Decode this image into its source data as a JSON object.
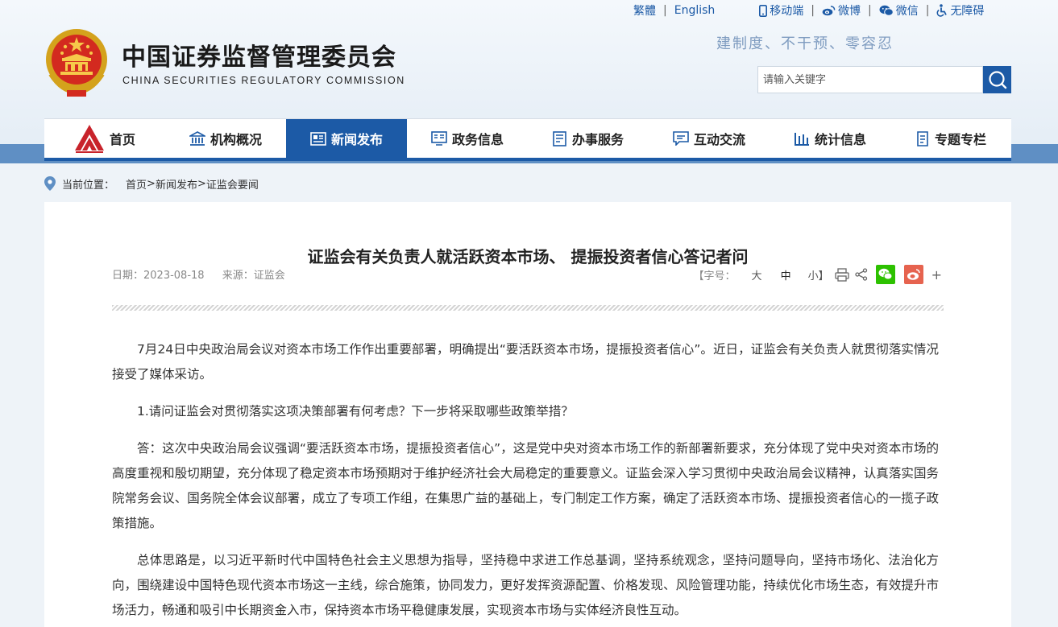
{
  "top_bar": {
    "traditional": "繁體",
    "english": "English",
    "links": [
      {
        "label": "移动端",
        "icon": "mobile-icon"
      },
      {
        "label": "微博",
        "icon": "weibo-icon"
      },
      {
        "label": "微信",
        "icon": "wechat-icon"
      },
      {
        "label": "无障碍",
        "icon": "accessibility-icon"
      }
    ]
  },
  "header": {
    "title": "中国证券监督管理委员会",
    "subtitle": "CHINA SECURITIES REGULATORY COMMISSION",
    "slogan": "建制度、不干预、零容忍",
    "search_placeholder": "请输入关键字"
  },
  "nav": {
    "items": [
      {
        "label": "首页",
        "icon": "home-logo-icon"
      },
      {
        "label": "机构概况",
        "icon": "institution-icon"
      },
      {
        "label": "新闻发布",
        "icon": "news-icon",
        "active": true
      },
      {
        "label": "政务信息",
        "icon": "government-info-icon"
      },
      {
        "label": "办事服务",
        "icon": "service-icon"
      },
      {
        "label": "互动交流",
        "icon": "chat-icon"
      },
      {
        "label": "统计信息",
        "icon": "statistics-icon"
      },
      {
        "label": "专题专栏",
        "icon": "topic-icon"
      }
    ]
  },
  "breadcrumb": {
    "prefix": "当前位置：",
    "items": [
      "首页",
      "新闻发布",
      "证监会要闻"
    ],
    "sep": ">"
  },
  "article": {
    "title": "证监会有关负责人就活跃资本市场、 提振投资者信心答记者问",
    "date_label": "日期：2023-08-18",
    "source_label": "来源：证监会",
    "font_size_label": "【字号：",
    "font_large": "大",
    "font_medium": "中",
    "font_small": "小】",
    "plus": "+",
    "paragraphs": [
      "7月24日中央政治局会议对资本市场工作作出重要部署，明确提出“要活跃资本市场，提振投资者信心”。近日，证监会有关负责人就贯彻落实情况接受了媒体采访。",
      "1.请问证监会对贯彻落实这项决策部署有何考虑？下一步将采取哪些政策举措？",
      "答：这次中央政治局会议强调“要活跃资本市场，提振投资者信心”，这是党中央对资本市场工作的新部署新要求，充分体现了党中央对资本市场的高度重视和殷切期望，充分体现了稳定资本市场预期对于维护经济社会大局稳定的重要意义。证监会深入学习贯彻中央政治局会议精神，认真落实国务院常务会议、国务院全体会议部署，成立了专项工作组，在集思广益的基础上，专门制定工作方案，确定了活跃资本市场、提振投资者信心的一揽子政策措施。",
      "总体思路是，以习近平新时代中国特色社会主义思想为指导，坚持稳中求进工作总基调，坚持系统观念，坚持问题导向，坚持市场化、法治化方向，围绕建设中国特色现代资本市场这一主线，综合施策，协同发力，更好发挥资源配置、价格发现、风险管理功能，持续优化市场生态，有效提升市场活力，畅通和吸引中长期资金入市，保持资本市场平稳健康发展，实现资本市场与实体经济良性互动。"
    ]
  },
  "colors": {
    "primary": "#1c5aa6",
    "band": "#5f8fc4",
    "wechat": "#2dc100",
    "weibo": "#e6634f"
  }
}
